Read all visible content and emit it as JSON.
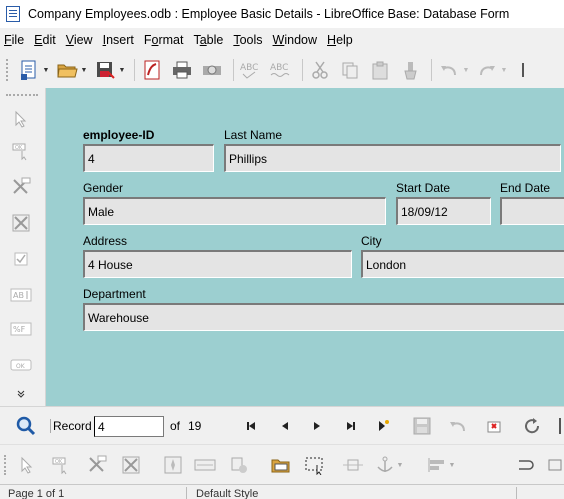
{
  "window": {
    "title": "Company Employees.odb : Employee Basic Details - LibreOffice Base: Database Form"
  },
  "menu": [
    {
      "accel": "F",
      "rest": "ile"
    },
    {
      "accel": "E",
      "rest": "dit"
    },
    {
      "accel": "V",
      "rest": "iew"
    },
    {
      "accel": "I",
      "rest": "nsert"
    },
    {
      "accel": "",
      "rest": "Format",
      "accel_mid": "o"
    },
    {
      "accel": "",
      "rest": "Table",
      "accel_mid": "b"
    },
    {
      "accel": "T",
      "rest": "ools"
    },
    {
      "accel": "W",
      "rest": "indow"
    },
    {
      "accel": "H",
      "rest": "elp"
    }
  ],
  "menu_labels": [
    "File",
    "Edit",
    "View",
    "Insert",
    "Format",
    "Table",
    "Tools",
    "Window",
    "Help"
  ],
  "form": {
    "employee_id_label": "employee-ID",
    "employee_id_value": "4",
    "last_name_label": "Last Name",
    "last_name_value": "Phillips",
    "gender_label": "Gender",
    "gender_value": "Male",
    "start_date_label": "Start Date",
    "start_date_value": "18/09/12",
    "end_date_label": "End Date",
    "end_date_value": "",
    "address_label": "Address",
    "address_value": "4 House",
    "city_label": "City",
    "city_value": "London",
    "department_label": "Department",
    "department_value": "Warehouse"
  },
  "navigation": {
    "record_label": "Record",
    "record_value": "4",
    "of_label": "of",
    "record_count": "19"
  },
  "status": {
    "page": "Page 1 of 1",
    "style": "Default Style"
  },
  "colors": {
    "form_background": "#9ccfd0",
    "field_background": "#e4e4e4"
  }
}
